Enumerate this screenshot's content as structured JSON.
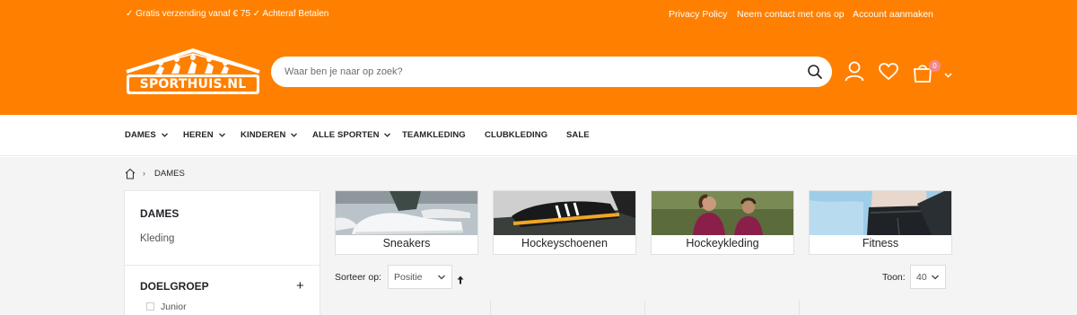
{
  "colors": {
    "brand": "#ff8000",
    "white": "#ffffff",
    "text": "#222529",
    "badge": "#f28a8a"
  },
  "topbar": {
    "usp": "✓ Gratis verzending vanaf € 75 ✓ Achteraf Betalen",
    "links": [
      "Privacy Policy",
      "Neem contact met ons op",
      "Account aanmaken"
    ]
  },
  "logo": {
    "text": "SPORTHUIS.NL"
  },
  "search": {
    "placeholder": "Waar ben je naar op zoek?",
    "value": "",
    "icon": "search-icon"
  },
  "header_icons": {
    "account": "user-icon",
    "wishlist": "heart-icon",
    "cart": "shopping-bag-icon",
    "cart_count": "0"
  },
  "nav": {
    "items": [
      {
        "label": "DAMES",
        "dropdown": true
      },
      {
        "label": "HEREN",
        "dropdown": true
      },
      {
        "label": "KINDEREN",
        "dropdown": true
      },
      {
        "label": "ALLE SPORTEN",
        "dropdown": true
      },
      {
        "label": "TEAMKLEDING",
        "dropdown": false
      },
      {
        "label": "CLUBKLEDING",
        "dropdown": false
      },
      {
        "label": "SALE",
        "dropdown": false
      }
    ]
  },
  "breadcrumb": {
    "home_icon": "home-icon",
    "separator": "›",
    "current": "DAMES"
  },
  "sidebar": {
    "title": "DAMES",
    "links": [
      "Kleding"
    ],
    "filters": [
      {
        "title": "DOELGROEP",
        "toggle": "+",
        "options": [
          "Junior"
        ]
      }
    ]
  },
  "categories": [
    {
      "label": "Sneakers"
    },
    {
      "label": "Hockeyschoenen"
    },
    {
      "label": "Hockeykleding"
    },
    {
      "label": "Fitness"
    }
  ],
  "toolbar": {
    "sort_label": "Sorteer op:",
    "sort_value": "Positie",
    "sort_direction_icon": "arrow-up-icon",
    "show_label": "Toon:",
    "show_value": "40"
  }
}
